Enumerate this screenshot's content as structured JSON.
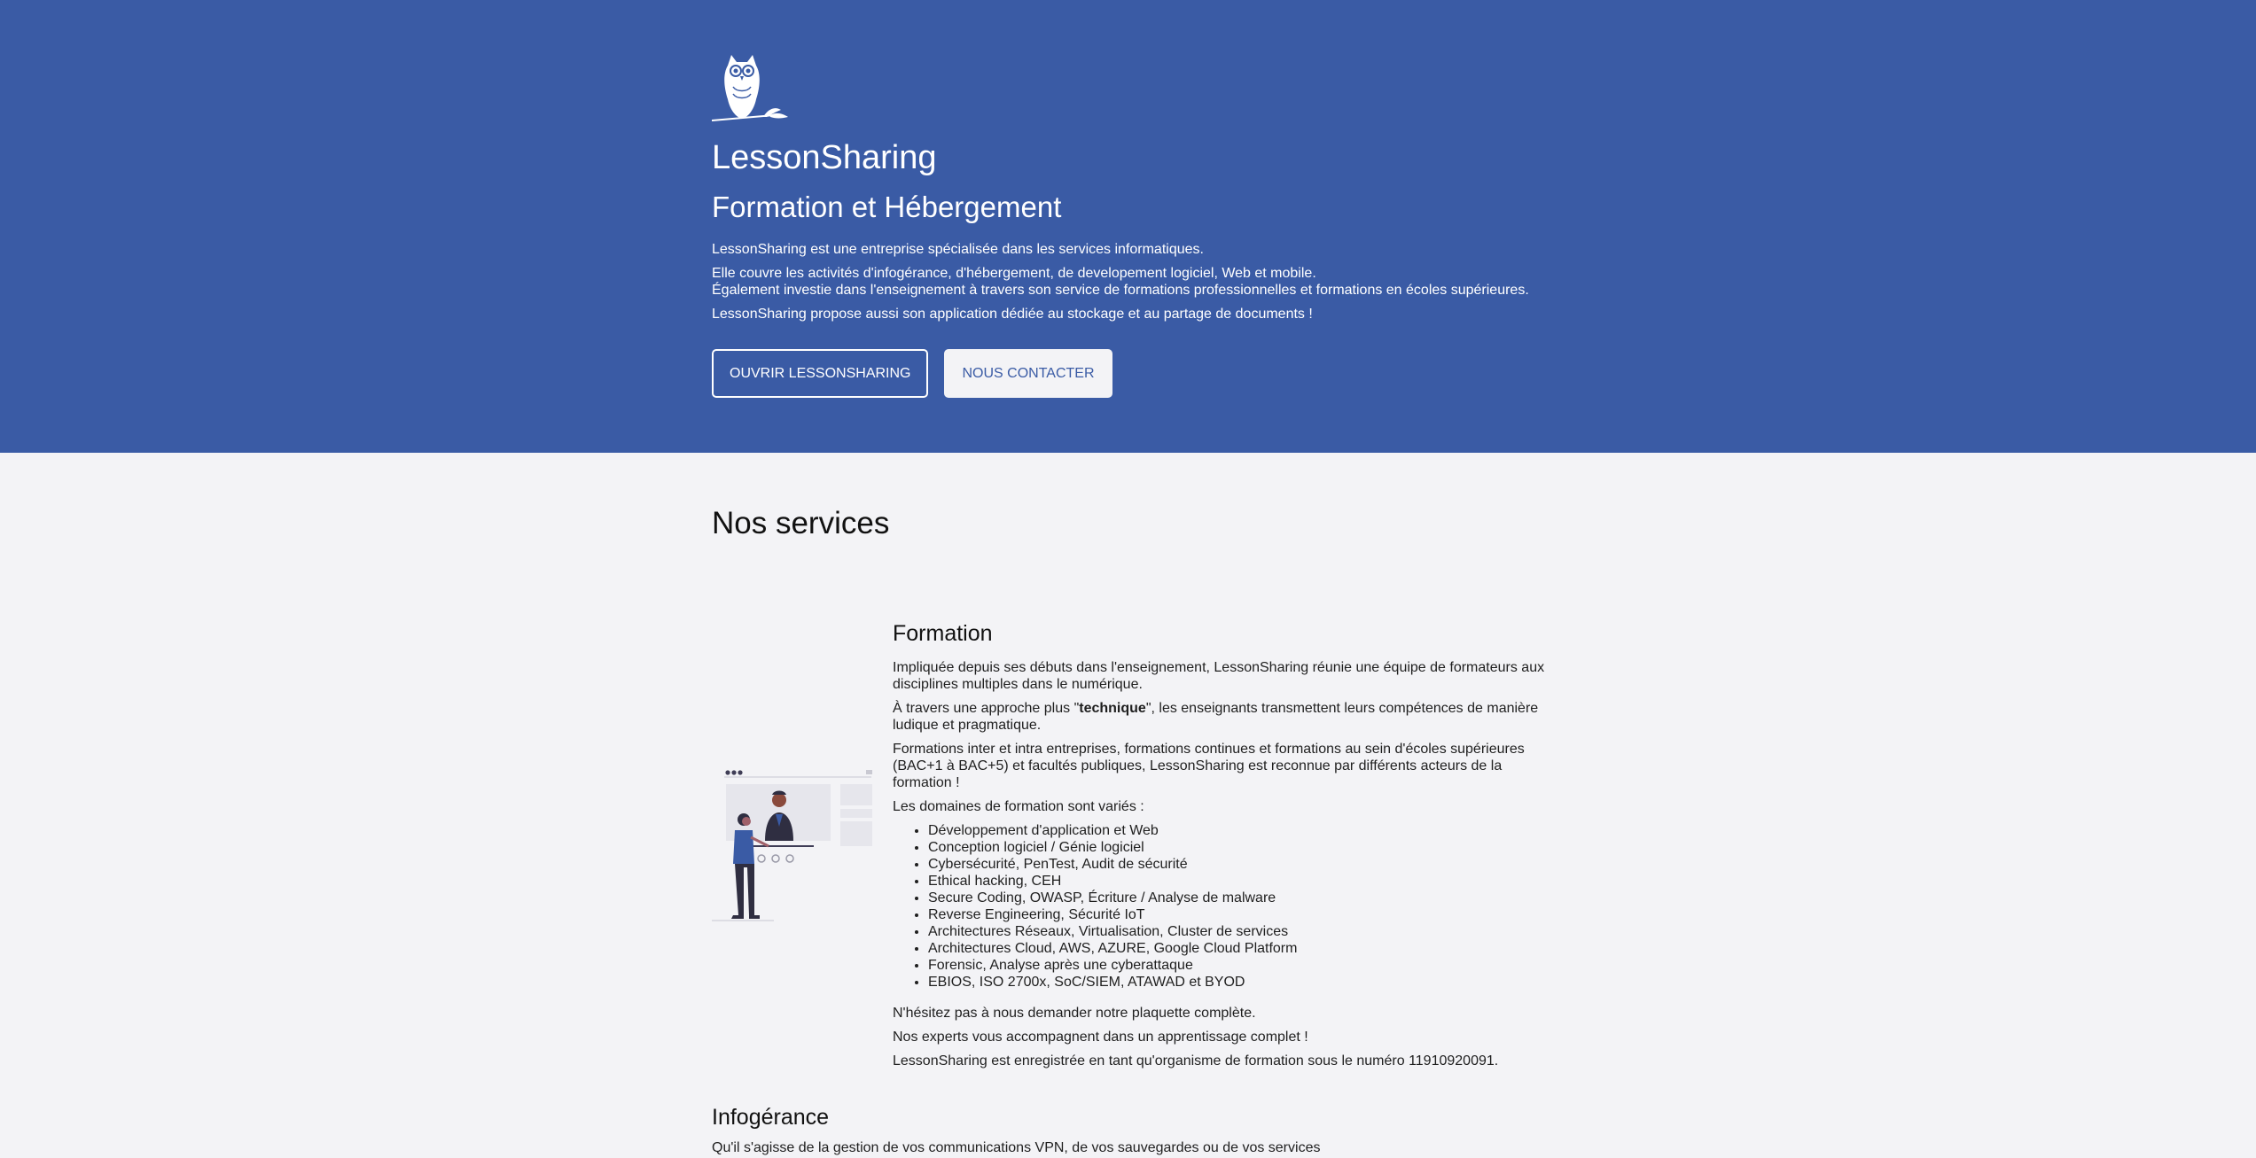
{
  "hero": {
    "brand": "LessonSharing",
    "tagline": "Formation et Hébergement",
    "lines": [
      "LessonSharing est une entreprise spécialisée dans les services informatiques.",
      "Elle couvre les activités d'infogérance, d'hébergement, de developement logiciel, Web et mobile.",
      "Également investie dans l'enseignement à travers son service de formations professionnelles et formations en écoles supérieures.",
      "LessonSharing propose aussi son application dédiée au stockage et au partage de documents !"
    ],
    "buttons": {
      "open": "OUVRIR LESSONSHARING",
      "contact": "NOUS CONTACTER"
    }
  },
  "services": {
    "title": "Nos services",
    "formation": {
      "title": "Formation",
      "p1": "Impliquée depuis ses débuts dans l'enseignement, LessonSharing réunie une équipe de formateurs aux disciplines multiples dans le numérique.",
      "p2_before": "À travers une approche plus \"",
      "p2_bold": "technique",
      "p2_after": "\", les enseignants transmettent leurs compétences de manière ludique et pragmatique.",
      "p3": "Formations inter et intra entreprises, formations continues et formations au sein d'écoles supérieures (BAC+1 à BAC+5) et facultés publiques, LessonSharing est reconnue par différents acteurs de la formation !",
      "p4": "Les domaines de formation sont variés :",
      "domains": [
        "Développement d'application et Web",
        "Conception logiciel / Génie logiciel",
        "Cybersécurité, PenTest, Audit de sécurité",
        "Ethical hacking, CEH",
        "Secure Coding, OWASP, Écriture / Analyse de malware",
        "Reverse Engineering, Sécurité IoT",
        "Architectures Réseaux, Virtualisation, Cluster de services",
        "Architectures Cloud, AWS, AZURE, Google Cloud Platform",
        "Forensic, Analyse après une cyberattaque",
        "EBIOS, ISO 2700x, SoC/SIEM, ATAWAD et BYOD"
      ],
      "p5": "N'hésitez pas à nous demander notre plaquette complète.",
      "p6": "Nos experts vous accompagnent dans un apprentissage complet !",
      "p7": "LessonSharing est enregistrée en tant qu'organisme de formation sous le numéro 11910920091."
    },
    "infogerance": {
      "title": "Infogérance",
      "p1": "Qu'il s'agisse de la gestion de vos communications VPN, de vos sauvegardes ou de vos services"
    }
  },
  "colors": {
    "hero_bg": "#3a5ba5",
    "page_bg": "#f3f3f6"
  },
  "icons": {
    "logo": "owl-logo-icon",
    "illustration": "presentation-illustration"
  }
}
